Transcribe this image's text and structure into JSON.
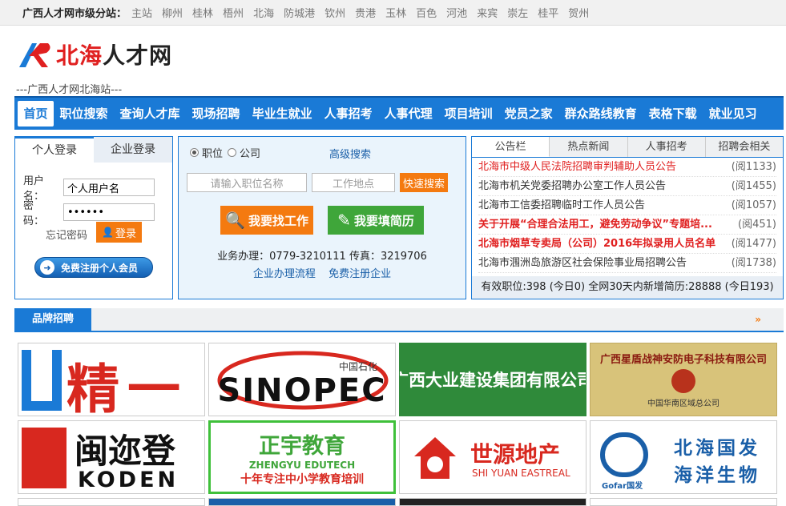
{
  "topbar": {
    "lead": "广西人才网市级分站：",
    "cities": [
      "主站",
      "柳州",
      "桂林",
      "梧州",
      "北海",
      "防城港",
      "钦州",
      "贵港",
      "玉林",
      "百色",
      "河池",
      "来宾",
      "崇左",
      "桂平",
      "贺州"
    ]
  },
  "logo": {
    "text": "北海人才网"
  },
  "tagline": "---广西人才网北海站---",
  "nav": [
    "首页",
    "职位搜索",
    "查询人才库",
    "现场招聘",
    "毕业生就业",
    "人事招考",
    "人事代理",
    "项目培训",
    "党员之家",
    "群众路线教育",
    "表格下载",
    "就业见习"
  ],
  "login": {
    "tab_personal": "个人登录",
    "tab_company": "企业登录",
    "user_label": "用户名：",
    "user_value": "个人用户名",
    "pwd_label": "密　码：",
    "pwd_value": "••••••",
    "forgot": "忘记密码",
    "login_btn": "登录",
    "register_btn": "免费注册个人会员"
  },
  "search": {
    "radio_job": "职位",
    "radio_company": "公司",
    "advanced": "高级搜索",
    "job_placeholder": "请输入职位名称",
    "location_placeholder": "工作地点",
    "quick": "快速搜索",
    "find_job": "我要找工作",
    "fill_resume": "我要填简历",
    "phone": "业务办理：0779-3210111 传真：3219706",
    "link_process": "企业办理流程",
    "link_register": "免费注册企业"
  },
  "notice": {
    "tabs": [
      "公告栏",
      "热点新闻",
      "人事招考",
      "招聘会相关"
    ],
    "items": [
      {
        "title": "北海市中级人民法院招聘审判辅助人员公告",
        "count": "(阅1133)",
        "style": "red"
      },
      {
        "title": "北海市机关党委招聘办公室工作人员公告",
        "count": "(阅1455)",
        "style": ""
      },
      {
        "title": "北海市工信委招聘临时工作人员公告",
        "count": "(阅1057)",
        "style": ""
      },
      {
        "title": "关于开展“合理合法用工，避免劳动争议”专题培...",
        "count": "(阅451)",
        "style": "redb"
      },
      {
        "title": "北海市烟草专卖局（公司）2016年拟录用人员名单",
        "count": "(阅1477)",
        "style": "redb"
      },
      {
        "title": "北海市涠洲岛旅游区社会保险事业局招聘公告",
        "count": "(阅1738)",
        "style": ""
      }
    ],
    "footer": "有效职位:398 (今日0) 全网30天内新增简历:28888 (今日193)"
  },
  "brand": {
    "title": "品牌招聘",
    "more": "»"
  },
  "tiles": [
    {
      "text": "精一",
      "sub": ""
    },
    {
      "text": "SINOPEC",
      "sub": "中国石化"
    },
    {
      "text": "广西大业建设集团有限公司",
      "sub": ""
    },
    {
      "text": "广西星盾战神安防电子科技有限公司",
      "sub": "中国华南区域总公司"
    },
    {
      "text": "闽迩登",
      "sub": "KODEN"
    },
    {
      "text": "正宇教育",
      "sub": "ZHENGYU EDUTECH",
      "sub2": "十年专注中小学教育培训"
    },
    {
      "text": "世源地产",
      "sub": "SHI YUAN EASTREAL"
    },
    {
      "text": "北海国发",
      "sub": "海洋生物",
      "sub2": "Gofar国发"
    }
  ],
  "colors": {
    "accent": "#1a7ad6",
    "orange": "#f47a10",
    "green": "#3fa63a",
    "red": "#e02020"
  }
}
